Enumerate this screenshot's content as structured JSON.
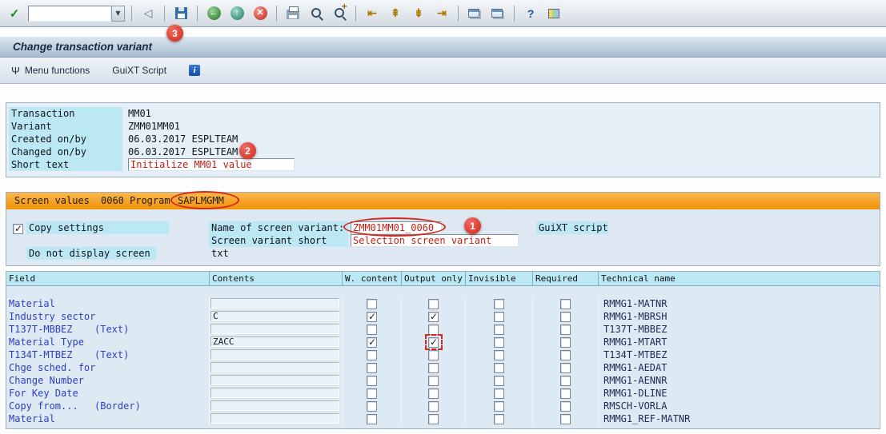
{
  "window": {
    "title": "Change transaction variant"
  },
  "toolbar": {
    "command_value": "",
    "icons": {
      "enter": "✓",
      "dropdown": "▼",
      "back_nav": "◁",
      "back": "←",
      "exit": "↑",
      "cancel": "✕",
      "first_page": "⇤",
      "page_up": "⇞",
      "page_down": "⇟",
      "last_page": "⇥",
      "help": "?"
    },
    "css_icons": [
      "save-icon",
      "print-icon",
      "find-icon",
      "find-next-icon",
      "new-session-icon",
      "create-shortcut-icon",
      "customize-layout-icon"
    ]
  },
  "app_toolbar": {
    "menu_icon": "Ψ",
    "menu_functions": "Menu functions",
    "guixt_script": "GuiXT Script",
    "info_icon": "i"
  },
  "details": {
    "rows": [
      {
        "label": "Transaction",
        "value": "MM01"
      },
      {
        "label": "Variant",
        "value": "ZMM01MM01"
      },
      {
        "label": "Created on/by",
        "value": "06.03.2017 ESPLTEAM"
      },
      {
        "label": "Changed on/by",
        "value": "06.03.2017 ESPLTEAM"
      },
      {
        "label": "Short text",
        "value": "Initialize MM01 value"
      }
    ]
  },
  "screen_values": {
    "label": "Screen values",
    "screen_number": "0060",
    "program_label": "Program",
    "program_name": "SAPLMGMM"
  },
  "options": {
    "copy_settings": {
      "label": "Copy settings",
      "checked": true
    },
    "do_not_display_screen": {
      "label": "Do not display screen",
      "checked": false
    },
    "guixt_script": {
      "label": "GuiXT script",
      "checked": false
    },
    "name_of_screen_variant": {
      "label": "Name of screen variant:",
      "value": "ZMM01MM01_0060"
    },
    "screen_variant_short_txt": {
      "label": "Screen variant short txt",
      "value": "Selection screen variant"
    }
  },
  "table": {
    "headers": [
      "Field",
      "Contents",
      "W. content",
      "Output only",
      "Invisible",
      "Required",
      "Technical name"
    ],
    "rows": [
      {
        "field": "Material",
        "qualifier": "",
        "contents": "",
        "w_content": false,
        "output_only": false,
        "invisible": false,
        "required": false,
        "technical_name": "RMMG1-MATNR"
      },
      {
        "field": "Industry sector",
        "qualifier": "",
        "contents": "C",
        "w_content": true,
        "output_only": true,
        "invisible": false,
        "required": false,
        "technical_name": "RMMG1-MBRSH"
      },
      {
        "field": "T137T-MBBEZ",
        "qualifier": "(Text)",
        "contents": "",
        "w_content": false,
        "output_only": false,
        "invisible": false,
        "required": false,
        "technical_name": "T137T-MBBEZ"
      },
      {
        "field": "Material Type",
        "qualifier": "",
        "contents": "ZACC",
        "w_content": true,
        "output_only": true,
        "invisible": false,
        "required": false,
        "technical_name": "RMMG1-MTART"
      },
      {
        "field": "T134T-MTBEZ",
        "qualifier": "(Text)",
        "contents": "",
        "w_content": false,
        "output_only": false,
        "invisible": false,
        "required": false,
        "technical_name": "T134T-MTBEZ"
      },
      {
        "field": "Chge sched. for",
        "qualifier": "",
        "contents": "",
        "w_content": false,
        "output_only": false,
        "invisible": false,
        "required": false,
        "technical_name": "RMMG1-AEDAT"
      },
      {
        "field": "Change Number",
        "qualifier": "",
        "contents": "",
        "w_content": false,
        "output_only": false,
        "invisible": false,
        "required": false,
        "technical_name": "RMMG1-AENNR"
      },
      {
        "field": "For Key Date",
        "qualifier": "",
        "contents": "",
        "w_content": false,
        "output_only": false,
        "invisible": false,
        "required": false,
        "technical_name": "RMMG1-DLINE"
      },
      {
        "field": "Copy from...",
        "qualifier": "(Border)",
        "contents": "",
        "w_content": false,
        "output_only": false,
        "invisible": false,
        "required": false,
        "technical_name": "RMSCH-VORLA"
      },
      {
        "field": "Material",
        "qualifier": "",
        "contents": "",
        "w_content": false,
        "output_only": false,
        "invisible": false,
        "required": false,
        "technical_name": "RMMG1_REF-MATNR"
      }
    ]
  },
  "annotations": {
    "badge_1": "1",
    "badge_2": "2",
    "badge_3": "3"
  }
}
